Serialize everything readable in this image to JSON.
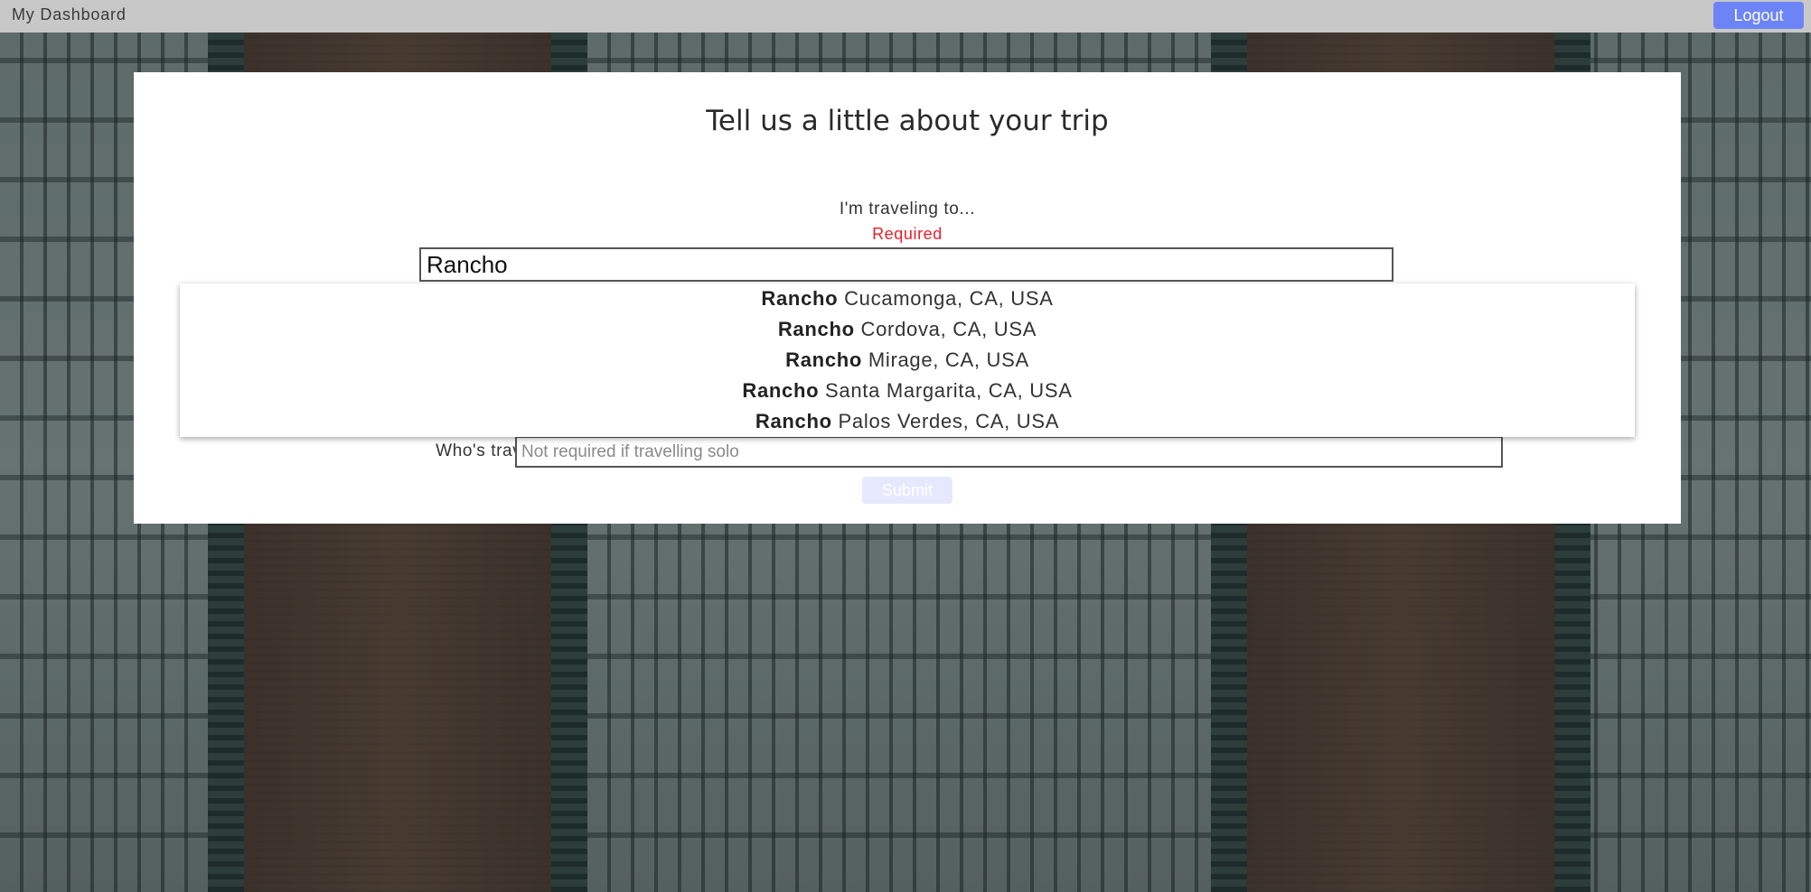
{
  "navbar": {
    "brand": "My Dashboard",
    "logout_label": "Logout"
  },
  "form": {
    "title": "Tell us a little about your trip",
    "destination": {
      "label": "I'm traveling to...",
      "required_text": "Required",
      "value": "Rancho"
    },
    "suggestions": [
      {
        "match": "Rancho",
        "rest": " Cucamonga, CA, USA"
      },
      {
        "match": "Rancho",
        "rest": " Cordova, CA, USA"
      },
      {
        "match": "Rancho",
        "rest": " Mirage, CA, USA"
      },
      {
        "match": "Rancho",
        "rest": " Santa Margarita, CA, USA"
      },
      {
        "match": "Rancho",
        "rest": " Palos Verdes, CA, USA"
      }
    ],
    "companions": {
      "label": "Who's traveling with you?",
      "placeholder": "Not required if travelling solo",
      "value": ""
    },
    "submit_label": "Submit"
  },
  "colors": {
    "navbar_bg": "#c8c8c8",
    "accent": "#6d84f7",
    "submit_disabled": "#e6e9fd",
    "required": "#e8202a"
  }
}
